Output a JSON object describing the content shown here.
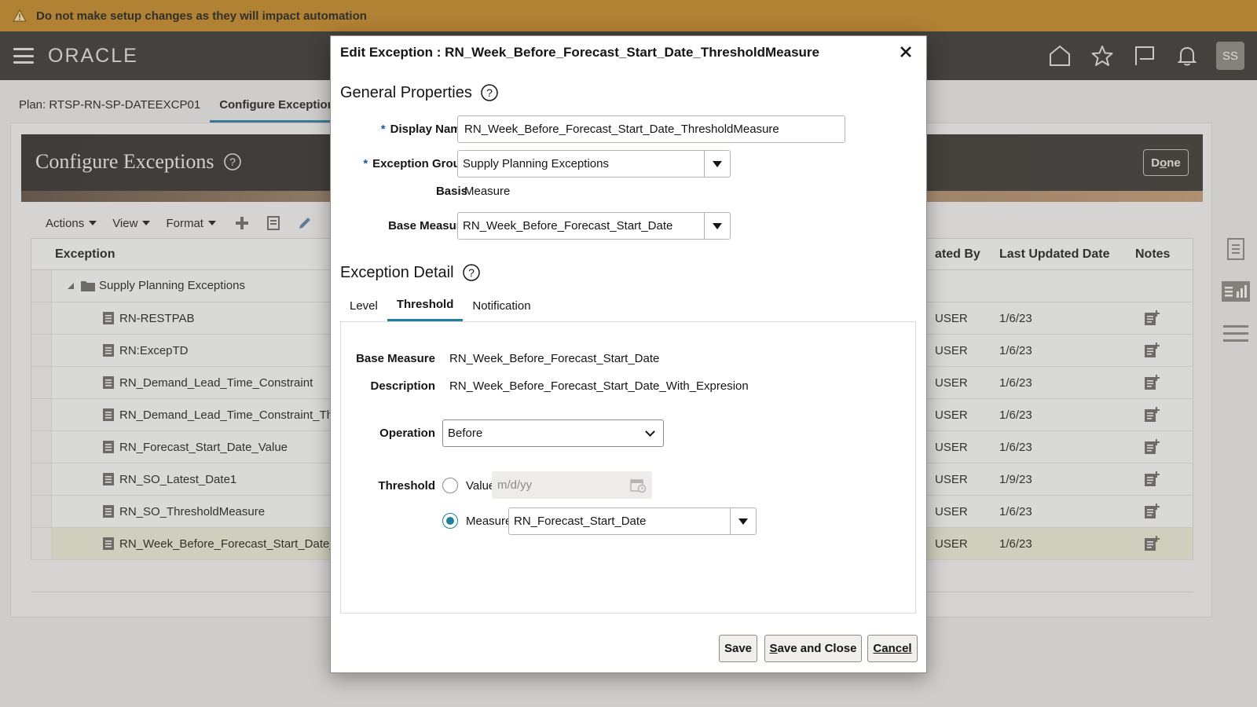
{
  "banner": {
    "text": "Do not make setup changes as they will impact automation"
  },
  "topbar": {
    "logo": "ORACLE",
    "avatar": "SS"
  },
  "subnav": {
    "plan": "Plan: RTSP-RN-SP-DATEEXCP01",
    "active_tab": "Configure Exception"
  },
  "page": {
    "title": "Configure Exceptions",
    "done_label": "Done"
  },
  "toolbar": {
    "actions": "Actions",
    "view": "View",
    "format": "Format"
  },
  "grid": {
    "headers": {
      "exception": "Exception",
      "updated_by": "ated By",
      "last_updated": "Last Updated Date",
      "notes": "Notes"
    },
    "group": "Supply Planning Exceptions",
    "rows": [
      {
        "name": "RN-RESTPAB",
        "by": "USER",
        "date": "1/6/23"
      },
      {
        "name": "RN:ExcepTD",
        "by": "USER",
        "date": "1/6/23"
      },
      {
        "name": "RN_Demand_Lead_Time_Constraint",
        "by": "USER",
        "date": "1/6/23"
      },
      {
        "name": "RN_Demand_Lead_Time_Constraint_Th",
        "by": "USER",
        "date": "1/6/23"
      },
      {
        "name": "RN_Forecast_Start_Date_Value",
        "by": "USER",
        "date": "1/6/23"
      },
      {
        "name": "RN_SO_Latest_Date1",
        "by": "USER",
        "date": "1/9/23"
      },
      {
        "name": "RN_SO_ThresholdMeasure",
        "by": "USER",
        "date": "1/6/23"
      },
      {
        "name": "RN_Week_Before_Forecast_Start_Date_",
        "by": "USER",
        "date": "1/6/23"
      }
    ]
  },
  "dialog": {
    "title": "Edit Exception : RN_Week_Before_Forecast_Start_Date_ThresholdMeasure",
    "general": {
      "title": "General Properties",
      "display_name_label": "Display Name",
      "display_name_value": "RN_Week_Before_Forecast_Start_Date_ThresholdMeasure",
      "exception_group_label": "Exception Group",
      "exception_group_value": "Supply Planning Exceptions",
      "basis_label": "Basis",
      "basis_value": "Measure",
      "base_measure_label": "Base Measure",
      "base_measure_value": "RN_Week_Before_Forecast_Start_Date"
    },
    "detail": {
      "title": "Exception Detail",
      "tabs": [
        "Level",
        "Threshold",
        "Notification"
      ],
      "base_measure_label": "Base Measure",
      "base_measure_value": "RN_Week_Before_Forecast_Start_Date",
      "description_label": "Description",
      "description_value": "RN_Week_Before_Forecast_Start_Date_With_Expresion",
      "operation_label": "Operation",
      "operation_value": "Before",
      "threshold_label": "Threshold",
      "value_option": "Value",
      "value_placeholder": "m/d/yy",
      "measure_option": "Measure",
      "measure_value": "RN_Forecast_Start_Date",
      "selected_option": "Measure"
    },
    "buttons": {
      "save": "Save",
      "save_close": "Save and Close",
      "cancel": "Cancel"
    }
  },
  "colors": {
    "banner": "#c8851c",
    "topbar": "#312d2a",
    "accent": "#227e9e"
  }
}
